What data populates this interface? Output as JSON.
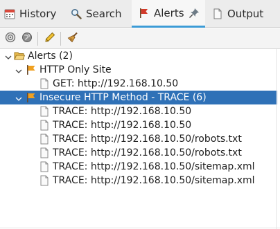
{
  "tabs": [
    {
      "label": "History",
      "icon": "history-icon"
    },
    {
      "label": "Search",
      "icon": "search-icon"
    },
    {
      "label": "Alerts",
      "icon": "alert-flag-icon",
      "active": true
    },
    {
      "label": "Output",
      "icon": "document-icon"
    }
  ],
  "toolbar": {
    "buttons": [
      "filter-icon",
      "globe-icon",
      "edit-icon",
      "broom-icon"
    ]
  },
  "tree": {
    "root": {
      "label": "Alerts (2)"
    },
    "alert1": {
      "label": "HTTP Only Site",
      "children": [
        "GET: http://192.168.10.50"
      ]
    },
    "alert2": {
      "label": "Insecure HTTP Method - TRACE (6)",
      "children": [
        "TRACE: http://192.168.10.50",
        "TRACE: http://192.168.10.50",
        "TRACE: http://192.168.10.50/robots.txt",
        "TRACE: http://192.168.10.50/robots.txt",
        "TRACE: http://192.168.10.50/sitemap.xml",
        "TRACE: http://192.168.10.50/sitemap.xml"
      ]
    }
  },
  "colors": {
    "selection": "#2f71b7",
    "tab_underline": "#3c9bd6",
    "flag_orange": "#f0a020",
    "flag_red": "#d23a2a"
  }
}
